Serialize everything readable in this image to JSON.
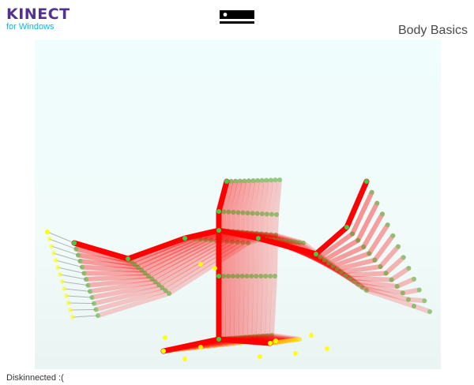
{
  "header": {
    "brand_main": "KINECT",
    "brand_sub": "for Windows",
    "sample_title": "Body Basics",
    "sensor_icon": "kinect-sensor-icon"
  },
  "status": {
    "text": "Diskinnected :("
  },
  "colors": {
    "bone": "#ff0000",
    "bone_trail": "#e8c8c8",
    "joint_tracked": "#44cc44",
    "joint_inferred": "#ffff00",
    "inferred_bone": "#888888",
    "brand": "#52318f",
    "brand_accent": "#00bcf2"
  }
}
